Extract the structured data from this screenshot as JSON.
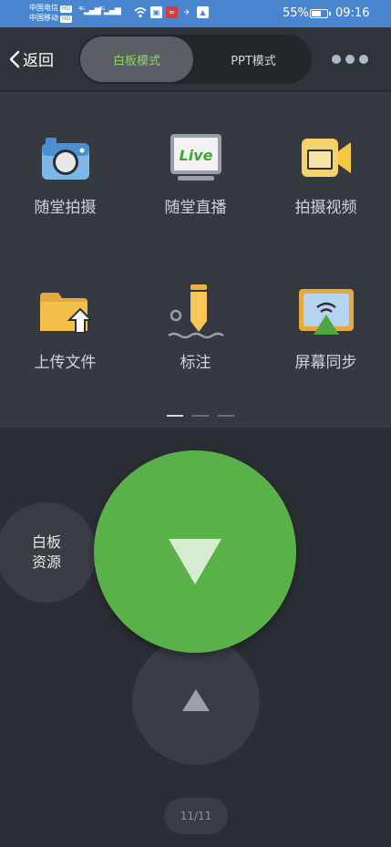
{
  "status_bar": {
    "carrier1": "中国电信",
    "carrier2": "中国移动",
    "hd": "HD",
    "battery_percent": "55%",
    "battery_level": 0.55,
    "time": "09:16"
  },
  "header": {
    "back_label": "返回",
    "modes": {
      "whiteboard": "白板模式",
      "ppt": "PPT模式"
    },
    "active_mode": "whiteboard"
  },
  "tools": [
    {
      "label": "随堂拍摄",
      "icon": "camera-icon"
    },
    {
      "label": "随堂直播",
      "icon": "live-tv-icon",
      "icon_text": "Live"
    },
    {
      "label": "拍摄视频",
      "icon": "video-camera-icon"
    },
    {
      "label": "上传文件",
      "icon": "upload-folder-icon"
    },
    {
      "label": "标注",
      "icon": "pen-annotate-icon"
    },
    {
      "label": "屏幕同步",
      "icon": "screen-cast-icon"
    }
  ],
  "pager": {
    "pages": 3,
    "current": 0
  },
  "remote": {
    "resource_label_line1": "白板",
    "resource_label_line2": "资源",
    "page_counter": "11/11"
  },
  "colors": {
    "status_bar": "#4a86d0",
    "accent_green": "#5ab14a",
    "active_mode_text": "#8fd16a",
    "background": "#2b2f35"
  }
}
